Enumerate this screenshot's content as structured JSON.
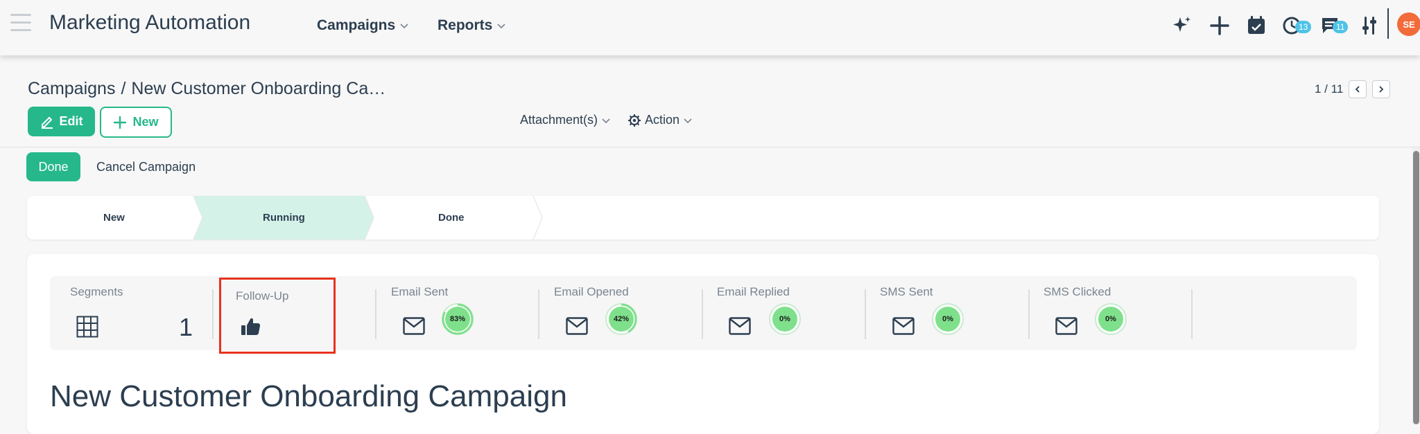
{
  "header": {
    "app_title": "Marketing Automation",
    "nav": [
      {
        "label": "Campaigns"
      },
      {
        "label": "Reports"
      }
    ],
    "activity_badge": "13",
    "messages_badge": "11",
    "avatar_initials": "SE"
  },
  "breadcrumb": {
    "root": "Campaigns",
    "separator": "/",
    "current": "New Customer Onboarding Ca…"
  },
  "pager": {
    "text": "1 / 11"
  },
  "toolbar": {
    "edit_label": "Edit",
    "new_label": "New",
    "attachments_label": "Attachment(s)",
    "action_label": "Action"
  },
  "status_actions": {
    "done_label": "Done",
    "cancel_label": "Cancel Campaign"
  },
  "stages": [
    {
      "label": "New",
      "active": false
    },
    {
      "label": "Running",
      "active": true
    },
    {
      "label": "Done",
      "active": false
    }
  ],
  "stats": {
    "segments": {
      "label": "Segments",
      "value": "1"
    },
    "follow_up": {
      "label": "Follow-Up"
    },
    "email_sent": {
      "label": "Email Sent",
      "percent": "83%",
      "fraction": 0.83
    },
    "email_opened": {
      "label": "Email Opened",
      "percent": "42%",
      "fraction": 0.42
    },
    "email_replied": {
      "label": "Email Replied",
      "percent": "0%",
      "fraction": 0
    },
    "sms_sent": {
      "label": "SMS Sent",
      "percent": "0%",
      "fraction": 0
    },
    "sms_clicked": {
      "label": "SMS Clicked",
      "percent": "0%",
      "fraction": 0
    }
  },
  "campaign_title": "New Customer Onboarding Campaign",
  "colors": {
    "accent": "#26b88a",
    "ring": "#7fe08c",
    "highlight": "#e8321e",
    "badge": "#4fc3e6",
    "avatar": "#f26b3a"
  }
}
